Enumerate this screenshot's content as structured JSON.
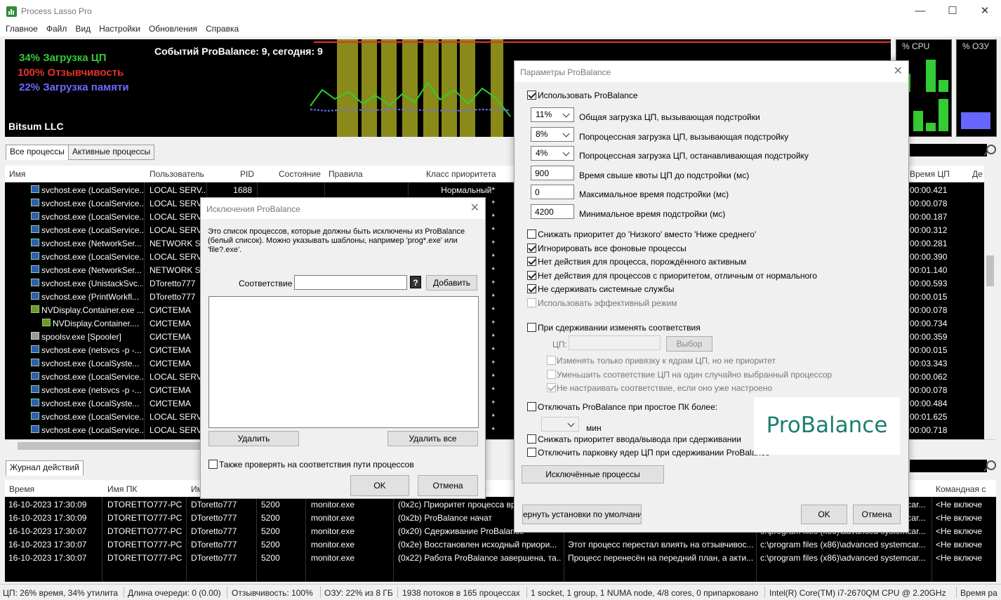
{
  "window": {
    "title": "Process Lasso Pro",
    "min": "—",
    "max": "☐",
    "close": "✕"
  },
  "menu": [
    "Главное",
    "Файл",
    "Вид",
    "Настройки",
    "Обновления",
    "Справка"
  ],
  "graph": {
    "cpu_load": "34% Загрузка ЦП",
    "responsiveness": "100% Отзывчивость",
    "memory_load": "22% Загрузка памяти",
    "events": "Событий ProBalance: 9, сегодня: 9",
    "company": "Bitsum LLC",
    "colors": {
      "cpu": "#33cc33",
      "resp": "#e8322a",
      "mem": "#6b6bff",
      "highlight": "#8a8a1a"
    },
    "cpu_meter_label": "% CPU",
    "ram_meter_label": "% ОЗУ",
    "cpu_meter_cores": [
      0.45,
      0.0,
      0.8,
      0.3,
      0.0,
      0.5,
      0.2,
      0.8
    ],
    "ram_level": 0.22
  },
  "tabs": {
    "all": "Все процессы",
    "active": "Активные процессы",
    "log": "Журнал действий"
  },
  "proc_columns": [
    "Имя",
    "Пользователь",
    "PID",
    "Состояние",
    "Правила",
    "Класс приоритета"
  ],
  "proc_right_columns": [
    "Время ЦП",
    "Де"
  ],
  "processes": [
    {
      "name": "svchost.exe (LocalService...",
      "user": "LOCAL SERV...",
      "pid": "1688",
      "prio": "Нормальный*",
      "time": "00:00.421",
      "icon": "svc"
    },
    {
      "name": "svchost.exe (LocalService...",
      "user": "LOCAL SERV...",
      "pid": "",
      "prio": "*",
      "time": "00:00.078",
      "icon": "svc"
    },
    {
      "name": "svchost.exe (LocalService...",
      "user": "LOCAL SERV...",
      "pid": "",
      "prio": "*",
      "time": "00:00.187",
      "icon": "svc"
    },
    {
      "name": "svchost.exe (LocalService...",
      "user": "LOCAL SERV...",
      "pid": "",
      "prio": "*",
      "time": "00:00.312",
      "icon": "svc"
    },
    {
      "name": "svchost.exe (NetworkSer...",
      "user": "NETWORK S...",
      "pid": "",
      "prio": "*",
      "time": "00:00.281",
      "icon": "svc"
    },
    {
      "name": "svchost.exe (LocalService...",
      "user": "LOCAL SERV...",
      "pid": "",
      "prio": "*",
      "time": "00:00.390",
      "icon": "svc"
    },
    {
      "name": "svchost.exe (NetworkSer...",
      "user": "NETWORK S...",
      "pid": "",
      "prio": "*",
      "time": "00:01.140",
      "icon": "svc"
    },
    {
      "name": "svchost.exe (UnistackSvc...",
      "user": "DToretto777",
      "pid": "",
      "prio": "*",
      "time": "00:00.593",
      "icon": "svc"
    },
    {
      "name": "svchost.exe (PrintWorkfl...",
      "user": "DToretto777",
      "pid": "",
      "prio": "*",
      "time": "00:00.015",
      "icon": "svc"
    },
    {
      "name": "NVDisplay.Container.exe ...",
      "user": "СИСТЕМА",
      "pid": "",
      "prio": "*",
      "time": "00:00.078",
      "icon": "nv"
    },
    {
      "name": "NVDisplay.Container....",
      "user": "СИСТЕМА",
      "pid": "",
      "prio": "*",
      "time": "00:00.734",
      "icon": "nv",
      "indent": true
    },
    {
      "name": "spoolsv.exe [Spooler]",
      "user": "СИСТЕМА",
      "pid": "",
      "prio": "*",
      "time": "00:00.359",
      "icon": "print"
    },
    {
      "name": "svchost.exe (netsvcs -p -...",
      "user": "СИСТЕМА",
      "pid": "",
      "prio": "*",
      "time": "00:00.015",
      "icon": "svc"
    },
    {
      "name": "svchost.exe (LocalSyste...",
      "user": "СИСТЕМА",
      "pid": "",
      "prio": "*",
      "time": "00:03.343",
      "icon": "svc"
    },
    {
      "name": "svchost.exe (LocalService...",
      "user": "LOCAL SERV...",
      "pid": "",
      "prio": "*",
      "time": "00:00.062",
      "icon": "svc"
    },
    {
      "name": "svchost.exe (netsvcs -p -...",
      "user": "СИСТЕМА",
      "pid": "",
      "prio": "*",
      "time": "00:00.078",
      "icon": "svc"
    },
    {
      "name": "svchost.exe (LocalSyste...",
      "user": "СИСТЕМА",
      "pid": "",
      "prio": "*",
      "time": "00:00.484",
      "icon": "svc"
    },
    {
      "name": "svchost.exe (LocalService...",
      "user": "LOCAL SERV...",
      "pid": "",
      "prio": "*",
      "time": "00:01.625",
      "icon": "svc"
    },
    {
      "name": "svchost.exe (LocalService...",
      "user": "LOCAL SERV...",
      "pid": "",
      "prio": "*",
      "time": "00:00.718",
      "icon": "svc"
    }
  ],
  "log_columns": [
    "Время",
    "Имя ПК",
    "Им",
    "",
    "",
    "",
    "",
    "Командная с"
  ],
  "log_rows": [
    {
      "time": "16-10-2023 17:30:09",
      "pc": "DTORETTO777-PC",
      "user": "DToretto777",
      "pid": "5200",
      "proc": "monitor.exe",
      "action": "(0x2c) Приоритет процесса вр",
      "desc": "",
      "path": "c:\\program files (x86)\\advanced systemcar...",
      "cmd": "<Не включе"
    },
    {
      "time": "16-10-2023 17:30:09",
      "pc": "DTORETTO777-PC",
      "user": "DToretto777",
      "pid": "5200",
      "proc": "monitor.exe",
      "action": "(0x2b) ProBalance начат",
      "desc": "",
      "path": "c:\\program files (x86)\\advanced systemcar...",
      "cmd": "<Не включе"
    },
    {
      "time": "16-10-2023 17:30:07",
      "pc": "DTORETTO777-PC",
      "user": "DToretto777",
      "pid": "5200",
      "proc": "monitor.exe",
      "action": "(0x20) Сдерживание ProBalance",
      "desc": "",
      "path": "c:\\program files (x86)\\advanced systemcar...",
      "cmd": "<Не включе"
    },
    {
      "time": "16-10-2023 17:30:07",
      "pc": "DTORETTO777-PC",
      "user": "DToretto777",
      "pid": "5200",
      "proc": "monitor.exe",
      "action": "(0x2e) Восстановлен исходный приори...",
      "desc": "Этот процесс перестал влиять на отзывчивос...",
      "path": "c:\\program files (x86)\\advanced systemcar...",
      "cmd": "<Не включе"
    },
    {
      "time": "16-10-2023 17:30:07",
      "pc": "DTORETTO777-PC",
      "user": "DToretto777",
      "pid": "5200",
      "proc": "monitor.exe",
      "action": "(0x22) Работа ProBalance завершена, та...",
      "desc": "Процесс перенесён на передний план, а акти...",
      "path": "c:\\program files (x86)\\advanced systemcar...",
      "cmd": "<Не включе"
    }
  ],
  "status": [
    "ЦП: 26% время, 34% утилита",
    "Длина очереди: 0 (0.00)",
    "Отзывчивость: 100%",
    "ОЗУ: 22% из 8 ГБ",
    "1938 потоков в 165 процессах",
    "1 socket, 1 group, 1 NUMA node, 4/8 cores, 0 припарковано",
    "Intel(R) Core(TM) i7-2670QM CPU @ 2.20GHz",
    "Время ра"
  ],
  "exclusions": {
    "title": "Исключения ProBalance",
    "description": "Это список процессов, которые должны быть исключены из ProBalance (белый список). Можно указывать шаблоны, например 'prog*.exe' или 'file?.exe'.",
    "match_label": "Соответствие",
    "match_value": "",
    "help": "?",
    "add": "Добавить",
    "remove": "Удалить",
    "remove_all": "Удалить все",
    "check_paths": "Также проверять на соответствия пути процессов",
    "ok": "OK",
    "cancel": "Отмена"
  },
  "params": {
    "title": "Параметры ProBalance",
    "use": "Использовать ProBalance",
    "fields": [
      {
        "value": "11%",
        "label": "Общая загрузка ЦП, вызывающая подстройки",
        "type": "combo"
      },
      {
        "value": "8%",
        "label": "Попроцессная загрузка ЦП, вызывающая подстройку",
        "type": "combo"
      },
      {
        "value": "4%",
        "label": "Попроцессная загрузка ЦП, останавливающая подстройку",
        "type": "combo"
      },
      {
        "value": "900",
        "label": "Время свыше квоты ЦП до подстройки (мс)",
        "type": "text"
      },
      {
        "value": "0",
        "label": "Максимальное время подстройки (мс)",
        "type": "text"
      },
      {
        "value": "4200",
        "label": "Минимальное время подстройки (мс)",
        "type": "text"
      }
    ],
    "options": [
      {
        "label": "Снижать приоритет до 'Низкого' вместо 'Ниже среднего'",
        "checked": false,
        "disabled": false
      },
      {
        "label": "Игнорировать все фоновые процессы",
        "checked": true,
        "disabled": false
      },
      {
        "label": "Нет действия для процесса, порождённого активным",
        "checked": true,
        "disabled": false
      },
      {
        "label": "Нет действия для процессов с приоритетом, отличным от нормального",
        "checked": true,
        "disabled": false
      },
      {
        "label": "Не сдерживать системные службы",
        "checked": true,
        "disabled": false
      },
      {
        "label": "Использовать эффективный режим",
        "checked": false,
        "disabled": true
      }
    ],
    "affinity_change": "При сдерживании изменять соответствия",
    "cpu_label": "ЦП:",
    "select": "Выбор",
    "affinity_opts": [
      {
        "label": "Изменять только привязку к ядрам ЦП, но не приоритет",
        "checked": false
      },
      {
        "label": "Уменьшить соответствие ЦП на один случайно выбранный процессор",
        "checked": false
      },
      {
        "label": "Не настраивать соответствие, если оно уже настроено",
        "checked": true
      }
    ],
    "idle_disable": "Отключать ProBalance при простое ПК более:",
    "minutes": "мин",
    "io_prio": "Снижать приоритет ввода/вывода при сдерживании",
    "park": "Отключить парковку ядер ЦП при сдерживании ProBalance",
    "logo": "ProBalance",
    "excluded_btn": "Исключённые процессы",
    "defaults_btn": "ернуть установки по умолчани",
    "ok": "OK",
    "cancel": "Отмена"
  }
}
